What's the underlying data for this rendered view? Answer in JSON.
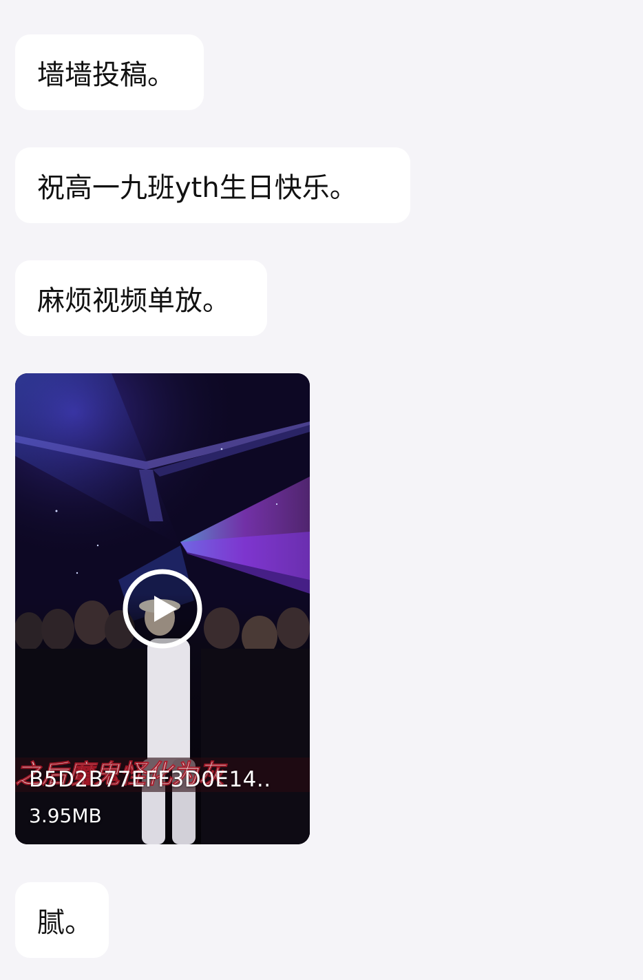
{
  "messages": [
    {
      "text": "墙墙投稿。"
    },
    {
      "text": "祝高一九班yth生日快乐。"
    },
    {
      "text": "麻烦视频单放。"
    },
    {
      "text": "腻。"
    }
  ],
  "video": {
    "file_name": "B5D2B77EFF3D0E14..",
    "file_size": "3.95MB",
    "play_icon": "play-circle-icon"
  },
  "colors": {
    "background": "#f5f4f8",
    "bubble": "#ffffff",
    "text": "#111111",
    "video_bg": "#0a0618",
    "laser_purple": "#b64cff",
    "laser_blue": "#4a6cff"
  }
}
